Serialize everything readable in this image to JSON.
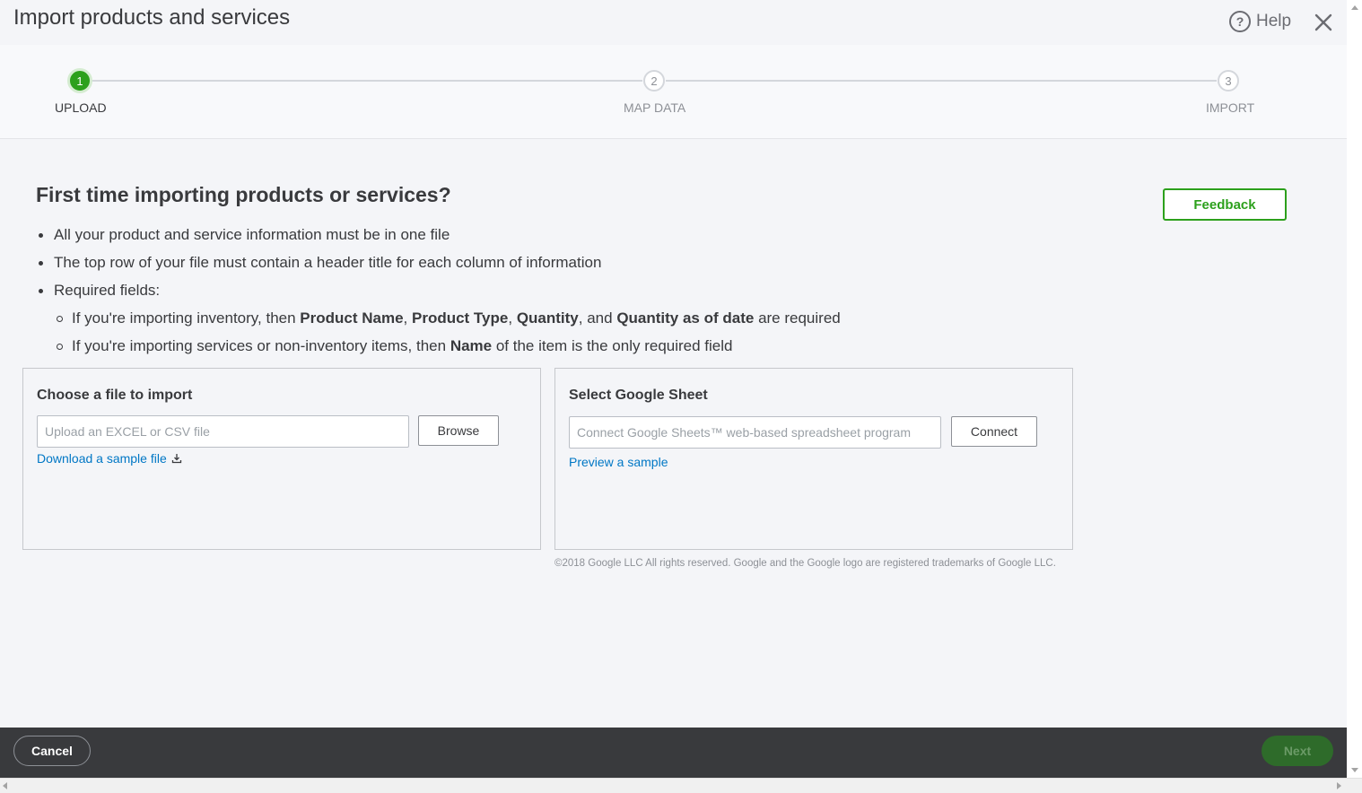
{
  "header": {
    "title": "Import products and services",
    "help_label": "Help",
    "help_icon": "question-circle-icon",
    "close_icon": "close-icon"
  },
  "stepper": {
    "steps": [
      {
        "number": "1",
        "label": "UPLOAD",
        "active": true
      },
      {
        "number": "2",
        "label": "MAP DATA",
        "active": false
      },
      {
        "number": "3",
        "label": "IMPORT",
        "active": false
      }
    ]
  },
  "intro": {
    "heading": "First time importing products or services?",
    "feedback_label": "Feedback",
    "bullet1": "All your product and service information must be in one file",
    "bullet2": "The top row of your file must contain a header title for each column of information",
    "bullet3": "Required fields:",
    "sub1": {
      "pre": "If you're importing inventory, then ",
      "f1": "Product Name",
      "s1": ", ",
      "f2": "Product Type",
      "s2": ", ",
      "f3": "Quantity",
      "s3": ", and ",
      "f4": "Quantity as of date",
      "post": " are required"
    },
    "sub2": {
      "pre": "If you're importing services or non-inventory items, then ",
      "f1": "Name",
      "post": " of the item is the only required field"
    }
  },
  "file_panel": {
    "title": "Choose a file to import",
    "input_placeholder": "Upload an EXCEL or CSV file",
    "input_value": "",
    "browse_label": "Browse",
    "download_link": "Download a sample file"
  },
  "sheet_panel": {
    "title": "Select Google Sheet",
    "input_placeholder": "Connect Google Sheets™ web-based spreadsheet program",
    "input_value": "",
    "connect_label": "Connect",
    "preview_link": "Preview a sample",
    "copyright": "©2018 Google LLC All rights reserved. Google and the Google logo are registered trademarks of Google LLC."
  },
  "footer": {
    "cancel_label": "Cancel",
    "next_label": "Next"
  },
  "colors": {
    "accent_green": "#2ca01c",
    "link_blue": "#0077c5",
    "footer_bg": "#393a3d",
    "next_disabled": "#2e6b2a"
  }
}
